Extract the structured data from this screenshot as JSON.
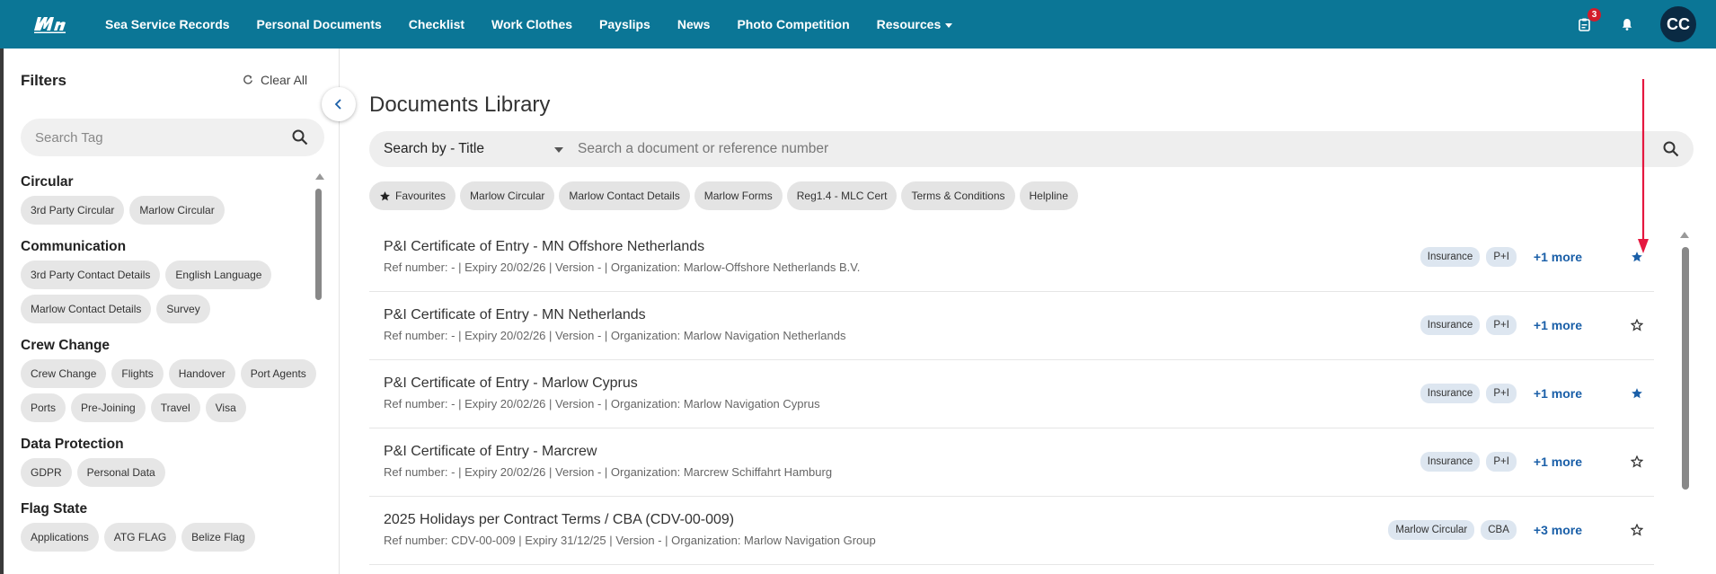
{
  "nav": {
    "items": [
      "Sea Service Records",
      "Personal Documents",
      "Checklist",
      "Work Clothes",
      "Payslips",
      "News",
      "Photo Competition",
      "Resources"
    ],
    "notification_badge": "3",
    "avatar_initials": "CC"
  },
  "sidebar": {
    "title": "Filters",
    "clear_all": "Clear All",
    "search_placeholder": "Search Tag",
    "groups": [
      {
        "title": "Circular",
        "tags": [
          "3rd Party Circular",
          "Marlow Circular"
        ]
      },
      {
        "title": "Communication",
        "tags": [
          "3rd Party Contact Details",
          "English Language",
          "Marlow Contact Details",
          "Survey"
        ]
      },
      {
        "title": "Crew Change",
        "tags": [
          "Crew Change",
          "Flights",
          "Handover",
          "Port Agents",
          "Ports",
          "Pre-Joining",
          "Travel",
          "Visa"
        ]
      },
      {
        "title": "Data Protection",
        "tags": [
          "GDPR",
          "Personal Data"
        ]
      },
      {
        "title": "Flag State",
        "tags": [
          "Applications",
          "ATG FLAG",
          "Belize Flag"
        ]
      }
    ]
  },
  "main": {
    "title": "Documents Library",
    "search_by": "Search by - Title",
    "search_placeholder": "Search a document or reference number",
    "quick_filters": [
      "Favourites",
      "Marlow Circular",
      "Marlow Contact Details",
      "Marlow Forms",
      "Reg1.4 - MLC Cert",
      "Terms & Conditions",
      "Helpline"
    ],
    "documents": [
      {
        "title": "P&I Certificate of Entry - MN Offshore Netherlands",
        "meta": "Ref number: - | Expiry 20/02/26 | Version - | Organization: Marlow-Offshore Netherlands B.V.",
        "tags": [
          "Insurance",
          "P+I"
        ],
        "more": "+1 more",
        "favourite": true
      },
      {
        "title": "P&I Certificate of Entry - MN Netherlands",
        "meta": "Ref number: - | Expiry 20/02/26 | Version - | Organization: Marlow Navigation Netherlands",
        "tags": [
          "Insurance",
          "P+I"
        ],
        "more": "+1 more",
        "favourite": false
      },
      {
        "title": "P&I Certificate of Entry - Marlow Cyprus",
        "meta": "Ref number: - | Expiry 20/02/26 | Version - | Organization: Marlow Navigation Cyprus",
        "tags": [
          "Insurance",
          "P+I"
        ],
        "more": "+1 more",
        "favourite": true
      },
      {
        "title": "P&I Certificate of Entry - Marcrew",
        "meta": "Ref number: - | Expiry 20/02/26 | Version - | Organization: Marcrew Schiffahrt Hamburg",
        "tags": [
          "Insurance",
          "P+I"
        ],
        "more": "+1 more",
        "favourite": false
      },
      {
        "title": "2025 Holidays per Contract Terms / CBA (CDV-00-009)",
        "meta": "Ref number: CDV-00-009 | Expiry 31/12/25 | Version - | Organization: Marlow Navigation Group",
        "tags": [
          "Marlow Circular",
          "CBA"
        ],
        "more": "+3 more",
        "favourite": false
      }
    ]
  },
  "colors": {
    "header": "#0b7696",
    "star_filled": "#1a5fa8",
    "arrow": "#e5173f"
  }
}
